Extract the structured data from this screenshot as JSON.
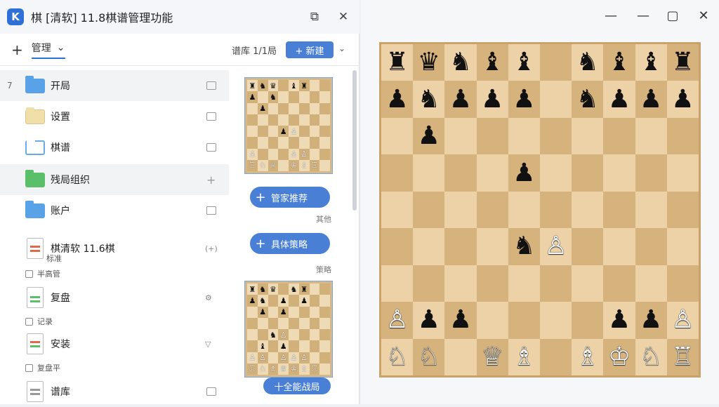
{
  "window": {
    "title": "棋 [清软] 11.8棋谱管理功能",
    "logo_letter": "K",
    "popout_icon": "⧉",
    "close_icon": "✕"
  },
  "toolbar": {
    "add_icon": "+",
    "manage_label": "管理",
    "manage_caret": "⌄",
    "status_text": "谱库 1/1局",
    "new_label": "+ 新建",
    "dropdown_caret": "⌄"
  },
  "folders": [
    {
      "caret": "7",
      "label": "开局",
      "color": "blue",
      "action": "check"
    },
    {
      "caret": "",
      "label": "设置",
      "color": "tan",
      "action": "check"
    },
    {
      "caret": "",
      "label": "棋谱",
      "color": "outline",
      "action": "check"
    },
    {
      "caret": "",
      "label": "残局组织",
      "color": "green",
      "action": "plus"
    },
    {
      "caret": "",
      "label": "账户",
      "color": "blue",
      "action": "check"
    }
  ],
  "docs": [
    {
      "label": "棋清软 11.6棋",
      "sub_label": "标准",
      "note": "半高管",
      "side": "(+)"
    },
    {
      "label": "复盘",
      "sub_label": "",
      "note": "记录",
      "side": "⚙"
    },
    {
      "label": "安装",
      "sub_label": "",
      "note": "复盘平",
      "side": "▽"
    },
    {
      "label": "谱库",
      "sub_label": "",
      "note": "",
      "side": "☐"
    }
  ],
  "preview": {
    "thumb1_rows": [
      "♜♞♛ ♝♜",
      "♟ ♞",
      " ♟",
      "",
      "   ♟♙",
      "",
      "♙   ♙♙",
      "♖♘♕ ♔♗♖"
    ],
    "thumb2_rows": [
      "♜♞♛ ♞♜",
      "♟♞ ♟ ♟",
      " ♟ ♟",
      "",
      "  ♞♙",
      " ♝ ♟",
      "♙♙ ♙♙♙",
      "♖♘♗♕♔♗♖"
    ],
    "pill1_label": "管家推荐",
    "pill1_caption": "其他",
    "pill2_label": "具体策略",
    "pill2_caption": "策略",
    "pill3_label": "十全能战局",
    "plus": "+"
  },
  "right_window": {
    "minimize_icon": "—",
    "maximize_icon": "—",
    "restore_icon": "▢",
    "close_icon": "✕"
  },
  "board": {
    "cols": 10,
    "rows": 9,
    "pieces": [
      {
        "r": 0,
        "c": 0,
        "p": "♜",
        "s": "b"
      },
      {
        "r": 0,
        "c": 1,
        "p": "♛",
        "s": "b"
      },
      {
        "r": 0,
        "c": 2,
        "p": "♞",
        "s": "b"
      },
      {
        "r": 0,
        "c": 3,
        "p": "♝",
        "s": "b"
      },
      {
        "r": 0,
        "c": 4,
        "p": "♝",
        "s": "b"
      },
      {
        "r": 0,
        "c": 6,
        "p": "♞",
        "s": "b"
      },
      {
        "r": 0,
        "c": 7,
        "p": "♝",
        "s": "b"
      },
      {
        "r": 0,
        "c": 8,
        "p": "♝",
        "s": "b"
      },
      {
        "r": 0,
        "c": 9,
        "p": "♜",
        "s": "b"
      },
      {
        "r": 1,
        "c": 0,
        "p": "♟",
        "s": "b"
      },
      {
        "r": 1,
        "c": 1,
        "p": "♞",
        "s": "b"
      },
      {
        "r": 1,
        "c": 2,
        "p": "♟",
        "s": "b"
      },
      {
        "r": 1,
        "c": 3,
        "p": "♟",
        "s": "b"
      },
      {
        "r": 1,
        "c": 4,
        "p": "♟",
        "s": "b"
      },
      {
        "r": 1,
        "c": 6,
        "p": "♞",
        "s": "b"
      },
      {
        "r": 1,
        "c": 7,
        "p": "♟",
        "s": "b"
      },
      {
        "r": 1,
        "c": 8,
        "p": "♟",
        "s": "b"
      },
      {
        "r": 1,
        "c": 9,
        "p": "♟",
        "s": "b"
      },
      {
        "r": 2,
        "c": 1,
        "p": "♟",
        "s": "b"
      },
      {
        "r": 3,
        "c": 4,
        "p": "♟",
        "s": "b"
      },
      {
        "r": 5,
        "c": 4,
        "p": "♞",
        "s": "b"
      },
      {
        "r": 5,
        "c": 5,
        "p": "♙",
        "s": "w"
      },
      {
        "r": 7,
        "c": 0,
        "p": "♙",
        "s": "w"
      },
      {
        "r": 7,
        "c": 1,
        "p": "♟",
        "s": "b"
      },
      {
        "r": 7,
        "c": 2,
        "p": "♟",
        "s": "b"
      },
      {
        "r": 7,
        "c": 7,
        "p": "♟",
        "s": "b"
      },
      {
        "r": 7,
        "c": 8,
        "p": "♟",
        "s": "b"
      },
      {
        "r": 7,
        "c": 9,
        "p": "♙",
        "s": "w"
      },
      {
        "r": 8,
        "c": 0,
        "p": "♘",
        "s": "w"
      },
      {
        "r": 8,
        "c": 1,
        "p": "♘",
        "s": "w"
      },
      {
        "r": 8,
        "c": 3,
        "p": "♕",
        "s": "w"
      },
      {
        "r": 8,
        "c": 4,
        "p": "♗",
        "s": "w"
      },
      {
        "r": 8,
        "c": 6,
        "p": "♗",
        "s": "w"
      },
      {
        "r": 8,
        "c": 7,
        "p": "♔",
        "s": "w"
      },
      {
        "r": 8,
        "c": 8,
        "p": "♘",
        "s": "w"
      },
      {
        "r": 8,
        "c": 9,
        "p": "♖",
        "s": "w"
      }
    ]
  }
}
